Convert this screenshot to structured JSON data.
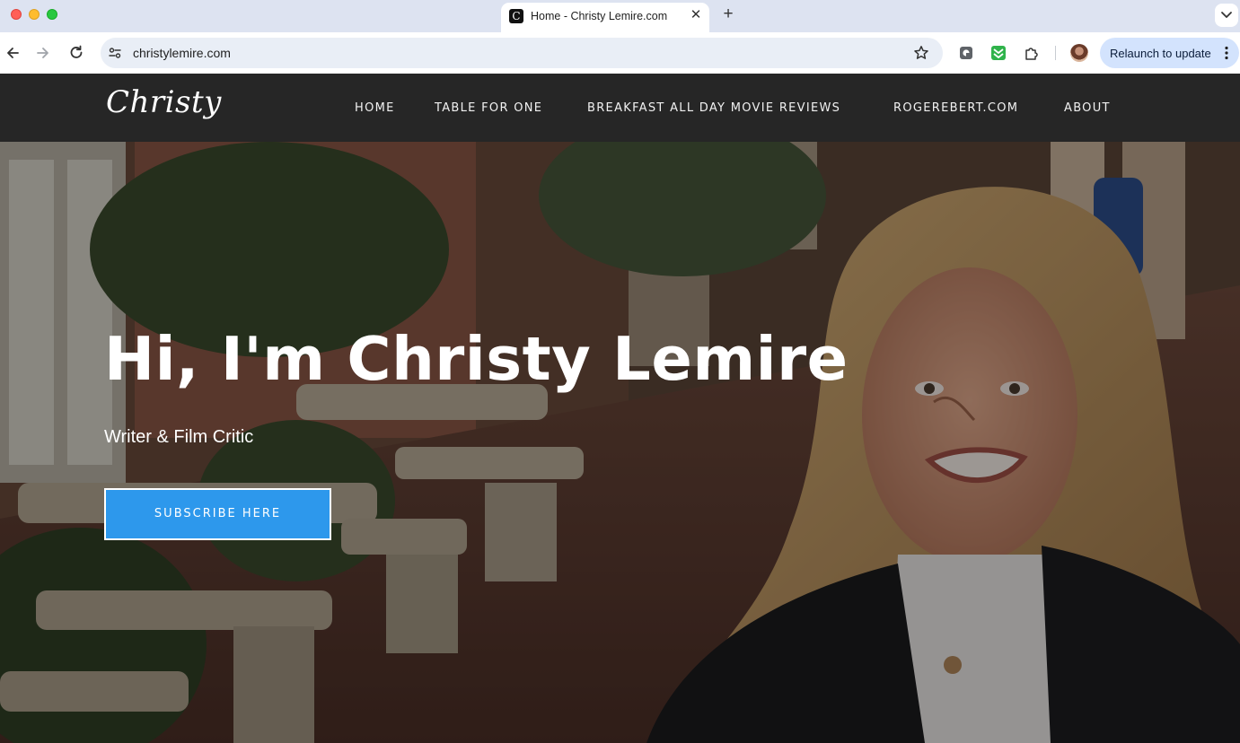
{
  "browser": {
    "tab_title": "Home - Christy Lemire.com",
    "tab_favicon_glyph": "C",
    "tab_close_glyph": "✕",
    "new_tab_glyph": "+",
    "url": "christylemire.com",
    "relaunch_label": "Relaunch to update",
    "icons": [
      "back-arrow-icon",
      "forward-arrow-icon",
      "reload-icon",
      "site-info-icon",
      "bookmark-star-icon",
      "extension-icon",
      "puzzle-extensions-icon",
      "kebab-menu-icon",
      "tab-search-icon"
    ],
    "colors": {
      "tabbar": "#dde3f1",
      "omnibox": "#e9eef6",
      "relaunch": "#d3e3fd"
    }
  },
  "site": {
    "logo": "Christy",
    "nav": [
      {
        "label": "HOME"
      },
      {
        "label": "TABLE FOR ONE"
      },
      {
        "label": "BREAKFAST ALL DAY MOVIE REVIEWS"
      },
      {
        "label": "ROGEREBERT.COM"
      },
      {
        "label": "ABOUT"
      }
    ],
    "colors": {
      "header": "#262626",
      "cta": "#2d98ec"
    }
  },
  "hero": {
    "title": "Hi, I'm Christy Lemire",
    "subtitle": "Writer & Film Critic",
    "cta_label": "SUBSCRIBE HERE"
  }
}
